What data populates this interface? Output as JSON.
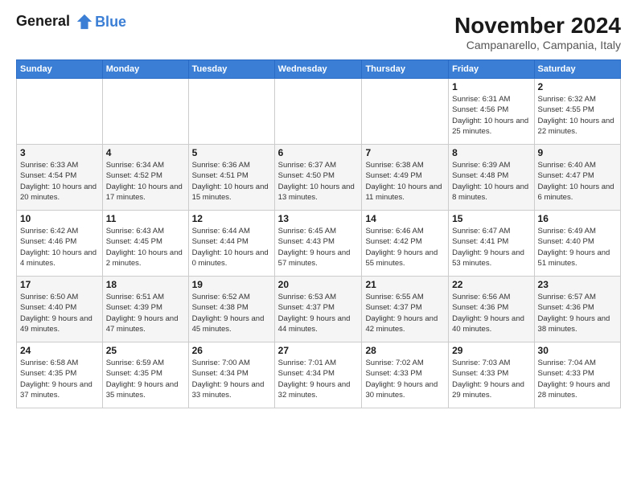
{
  "logo": {
    "line1": "General",
    "line2": "Blue"
  },
  "title": "November 2024",
  "subtitle": "Campanarello, Campania, Italy",
  "days_header": [
    "Sunday",
    "Monday",
    "Tuesday",
    "Wednesday",
    "Thursday",
    "Friday",
    "Saturday"
  ],
  "weeks": [
    [
      {
        "day": "",
        "info": ""
      },
      {
        "day": "",
        "info": ""
      },
      {
        "day": "",
        "info": ""
      },
      {
        "day": "",
        "info": ""
      },
      {
        "day": "",
        "info": ""
      },
      {
        "day": "1",
        "info": "Sunrise: 6:31 AM\nSunset: 4:56 PM\nDaylight: 10 hours\nand 25 minutes."
      },
      {
        "day": "2",
        "info": "Sunrise: 6:32 AM\nSunset: 4:55 PM\nDaylight: 10 hours\nand 22 minutes."
      }
    ],
    [
      {
        "day": "3",
        "info": "Sunrise: 6:33 AM\nSunset: 4:54 PM\nDaylight: 10 hours\nand 20 minutes."
      },
      {
        "day": "4",
        "info": "Sunrise: 6:34 AM\nSunset: 4:52 PM\nDaylight: 10 hours\nand 17 minutes."
      },
      {
        "day": "5",
        "info": "Sunrise: 6:36 AM\nSunset: 4:51 PM\nDaylight: 10 hours\nand 15 minutes."
      },
      {
        "day": "6",
        "info": "Sunrise: 6:37 AM\nSunset: 4:50 PM\nDaylight: 10 hours\nand 13 minutes."
      },
      {
        "day": "7",
        "info": "Sunrise: 6:38 AM\nSunset: 4:49 PM\nDaylight: 10 hours\nand 11 minutes."
      },
      {
        "day": "8",
        "info": "Sunrise: 6:39 AM\nSunset: 4:48 PM\nDaylight: 10 hours\nand 8 minutes."
      },
      {
        "day": "9",
        "info": "Sunrise: 6:40 AM\nSunset: 4:47 PM\nDaylight: 10 hours\nand 6 minutes."
      }
    ],
    [
      {
        "day": "10",
        "info": "Sunrise: 6:42 AM\nSunset: 4:46 PM\nDaylight: 10 hours\nand 4 minutes."
      },
      {
        "day": "11",
        "info": "Sunrise: 6:43 AM\nSunset: 4:45 PM\nDaylight: 10 hours\nand 2 minutes."
      },
      {
        "day": "12",
        "info": "Sunrise: 6:44 AM\nSunset: 4:44 PM\nDaylight: 10 hours\nand 0 minutes."
      },
      {
        "day": "13",
        "info": "Sunrise: 6:45 AM\nSunset: 4:43 PM\nDaylight: 9 hours\nand 57 minutes."
      },
      {
        "day": "14",
        "info": "Sunrise: 6:46 AM\nSunset: 4:42 PM\nDaylight: 9 hours\nand 55 minutes."
      },
      {
        "day": "15",
        "info": "Sunrise: 6:47 AM\nSunset: 4:41 PM\nDaylight: 9 hours\nand 53 minutes."
      },
      {
        "day": "16",
        "info": "Sunrise: 6:49 AM\nSunset: 4:40 PM\nDaylight: 9 hours\nand 51 minutes."
      }
    ],
    [
      {
        "day": "17",
        "info": "Sunrise: 6:50 AM\nSunset: 4:40 PM\nDaylight: 9 hours\nand 49 minutes."
      },
      {
        "day": "18",
        "info": "Sunrise: 6:51 AM\nSunset: 4:39 PM\nDaylight: 9 hours\nand 47 minutes."
      },
      {
        "day": "19",
        "info": "Sunrise: 6:52 AM\nSunset: 4:38 PM\nDaylight: 9 hours\nand 45 minutes."
      },
      {
        "day": "20",
        "info": "Sunrise: 6:53 AM\nSunset: 4:37 PM\nDaylight: 9 hours\nand 44 minutes."
      },
      {
        "day": "21",
        "info": "Sunrise: 6:55 AM\nSunset: 4:37 PM\nDaylight: 9 hours\nand 42 minutes."
      },
      {
        "day": "22",
        "info": "Sunrise: 6:56 AM\nSunset: 4:36 PM\nDaylight: 9 hours\nand 40 minutes."
      },
      {
        "day": "23",
        "info": "Sunrise: 6:57 AM\nSunset: 4:36 PM\nDaylight: 9 hours\nand 38 minutes."
      }
    ],
    [
      {
        "day": "24",
        "info": "Sunrise: 6:58 AM\nSunset: 4:35 PM\nDaylight: 9 hours\nand 37 minutes."
      },
      {
        "day": "25",
        "info": "Sunrise: 6:59 AM\nSunset: 4:35 PM\nDaylight: 9 hours\nand 35 minutes."
      },
      {
        "day": "26",
        "info": "Sunrise: 7:00 AM\nSunset: 4:34 PM\nDaylight: 9 hours\nand 33 minutes."
      },
      {
        "day": "27",
        "info": "Sunrise: 7:01 AM\nSunset: 4:34 PM\nDaylight: 9 hours\nand 32 minutes."
      },
      {
        "day": "28",
        "info": "Sunrise: 7:02 AM\nSunset: 4:33 PM\nDaylight: 9 hours\nand 30 minutes."
      },
      {
        "day": "29",
        "info": "Sunrise: 7:03 AM\nSunset: 4:33 PM\nDaylight: 9 hours\nand 29 minutes."
      },
      {
        "day": "30",
        "info": "Sunrise: 7:04 AM\nSunset: 4:33 PM\nDaylight: 9 hours\nand 28 minutes."
      }
    ]
  ]
}
